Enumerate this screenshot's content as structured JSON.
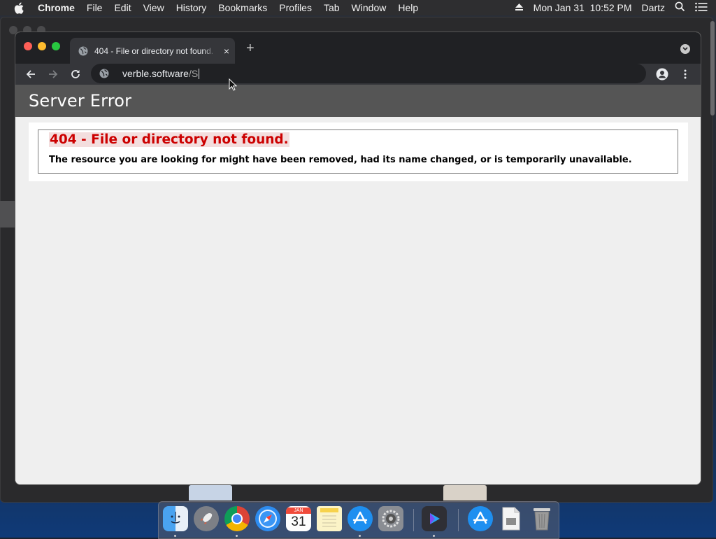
{
  "menubar": {
    "app_name": "Chrome",
    "items": [
      "File",
      "Edit",
      "View",
      "History",
      "Bookmarks",
      "Profiles",
      "Tab",
      "Window",
      "Help"
    ],
    "datetime": "Mon Jan 31  10:52 PM",
    "user": "Dartz"
  },
  "browser": {
    "tab_title": "404 - File or directory not found.",
    "tab_close": "×",
    "new_tab": "+",
    "url_host": "verble.software",
    "url_path": "/S"
  },
  "page": {
    "header": "Server Error",
    "error_title": "404 - File or directory not found.",
    "error_message": "The resource you are looking for might have been removed, had its name changed, or is temporarily unavailable."
  },
  "dock": {
    "calendar_month": "JAN",
    "calendar_day": "31"
  },
  "colors": {
    "header_bg": "#555555",
    "error_red": "#cc0000",
    "chrome_dark": "#202124",
    "chrome_toolbar": "#35363a"
  }
}
